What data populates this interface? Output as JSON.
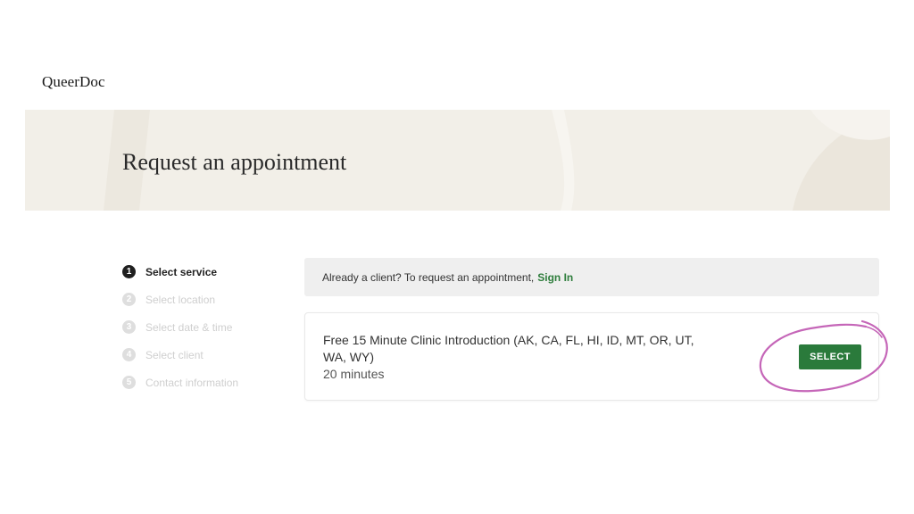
{
  "header": {
    "logo_text": "QueerDoc"
  },
  "hero": {
    "title": "Request an appointment"
  },
  "steps": [
    {
      "number": "1",
      "label": "Select service",
      "active": true
    },
    {
      "number": "2",
      "label": "Select location",
      "active": false
    },
    {
      "number": "3",
      "label": "Select date & time",
      "active": false
    },
    {
      "number": "4",
      "label": "Select client",
      "active": false
    },
    {
      "number": "5",
      "label": "Contact information",
      "active": false
    }
  ],
  "client_banner": {
    "text": "Already a client? To request an appointment,",
    "sign_in_label": "Sign In"
  },
  "service": {
    "name": "Free 15 Minute Clinic Introduction (AK, CA, FL, HI, ID, MT, OR, UT, WA, WY)",
    "duration": "20 minutes",
    "select_label": "SELECT"
  },
  "colors": {
    "accent_green": "#2a7a3b",
    "hero_background": "#f2efe8",
    "annotation_pink": "#c566b8"
  }
}
